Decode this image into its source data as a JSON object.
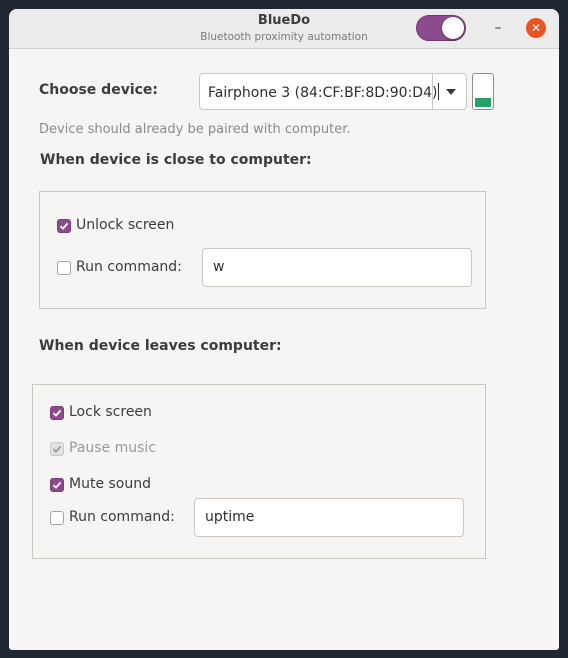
{
  "window": {
    "title": "BlueDo",
    "subtitle": "Bluetooth proximity automation",
    "enabled_toggle": true,
    "minimize_glyph": "–",
    "close_glyph": "✕",
    "accent_color": "#8b4b8c",
    "close_color": "#e95420"
  },
  "device": {
    "label": "Choose device:",
    "selected": "Fairphone 3 (84:CF:BF:8D:90:D4)",
    "hint": "Device should already be paired with computer.",
    "battery_icon": "battery-icon",
    "battery_level": 0.3
  },
  "close_section": {
    "heading": "When device is close to computer:",
    "unlock_screen": {
      "label": "Unlock screen",
      "checked": true
    },
    "run_command": {
      "label": "Run command:",
      "checked": false,
      "value": "w"
    }
  },
  "leave_section": {
    "heading": "When device leaves computer:",
    "lock_screen": {
      "label": "Lock screen",
      "checked": true
    },
    "pause_music": {
      "label": "Pause music",
      "checked": true,
      "disabled": true
    },
    "mute_sound": {
      "label": "Mute sound",
      "checked": true
    },
    "run_command": {
      "label": "Run command:",
      "checked": false,
      "value": "uptime"
    }
  }
}
